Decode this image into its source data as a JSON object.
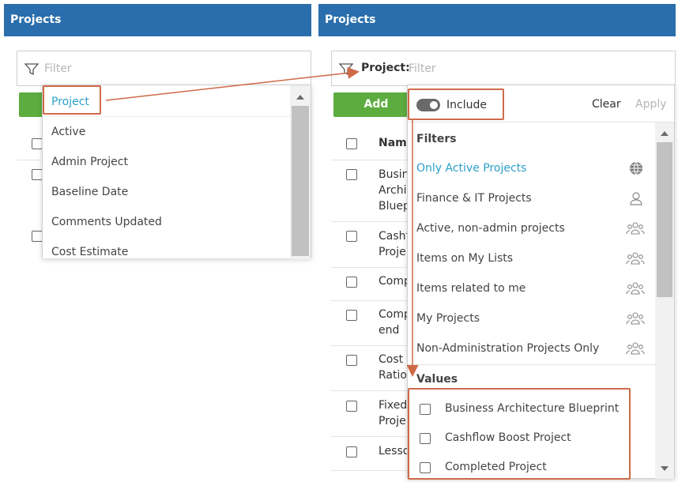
{
  "left": {
    "header": "Projects",
    "filter_placeholder": "Filter",
    "dropdown_items": [
      "Project",
      "Active",
      "Admin Project",
      "Baseline Date",
      "Comments Updated",
      "Cost Estimate"
    ]
  },
  "right": {
    "header": "Projects",
    "filter_label": "Project:",
    "filter_placeholder": "Filter",
    "add_label": "Add",
    "name_col": "Name",
    "rows": [
      [
        "Busin",
        "Archit",
        "Bluep"
      ],
      [
        "Cashf",
        "Proje"
      ],
      [
        "Comp"
      ],
      [
        "Comp",
        "end"
      ],
      [
        "Cost f",
        "Ratio"
      ],
      [
        "Fixed",
        "Proje"
      ],
      [
        "Lesso"
      ]
    ],
    "popup": {
      "include_label": "Include",
      "clear_label": "Clear",
      "apply_label": "Apply",
      "filters_title": "Filters",
      "filters": [
        {
          "label": "Only Active Projects",
          "icon": "globe-icon"
        },
        {
          "label": "Finance & IT Projects",
          "icon": "user-icon"
        },
        {
          "label": "Active, non-admin projects",
          "icon": "group-icon"
        },
        {
          "label": "Items on My Lists",
          "icon": "group-icon"
        },
        {
          "label": "Items related to me",
          "icon": "group-icon"
        },
        {
          "label": "My Projects",
          "icon": "group-icon"
        },
        {
          "label": "Non-Administration Projects Only",
          "icon": "group-icon"
        }
      ],
      "values_title": "Values",
      "values": [
        "Business Architecture Blueprint",
        "Cashflow Boost Project",
        "Completed Project"
      ]
    }
  },
  "colors": {
    "header": "#2a6ead",
    "add": "#5cac3f",
    "accent": "#2aa0c8",
    "highlight": "#cf6a48"
  }
}
